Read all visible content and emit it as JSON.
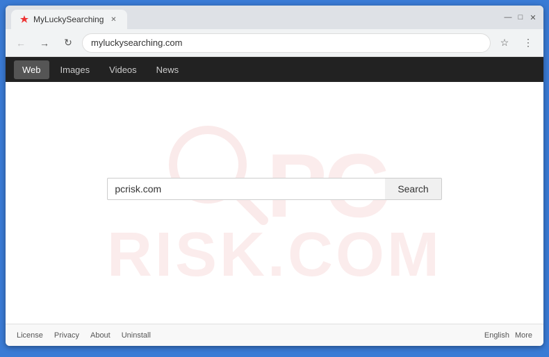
{
  "browser": {
    "tab_title": "MyLuckySearching",
    "url": "myluckysearching.com",
    "window_controls": {
      "minimize": "—",
      "maximize": "□",
      "close": "✕"
    }
  },
  "navbar": {
    "items": [
      {
        "label": "Web",
        "active": true
      },
      {
        "label": "Images",
        "active": false
      },
      {
        "label": "Videos",
        "active": false
      },
      {
        "label": "News",
        "active": false
      }
    ]
  },
  "search": {
    "placeholder": "",
    "value": "pcrisk.com",
    "button_label": "Search"
  },
  "watermark": {
    "pc": "PC",
    "risk": "RISK",
    "com": ".COM"
  },
  "footer": {
    "links": [
      {
        "label": "License"
      },
      {
        "label": "Privacy"
      },
      {
        "label": "About"
      },
      {
        "label": "Uninstall"
      }
    ],
    "language": "English",
    "more": "More"
  }
}
